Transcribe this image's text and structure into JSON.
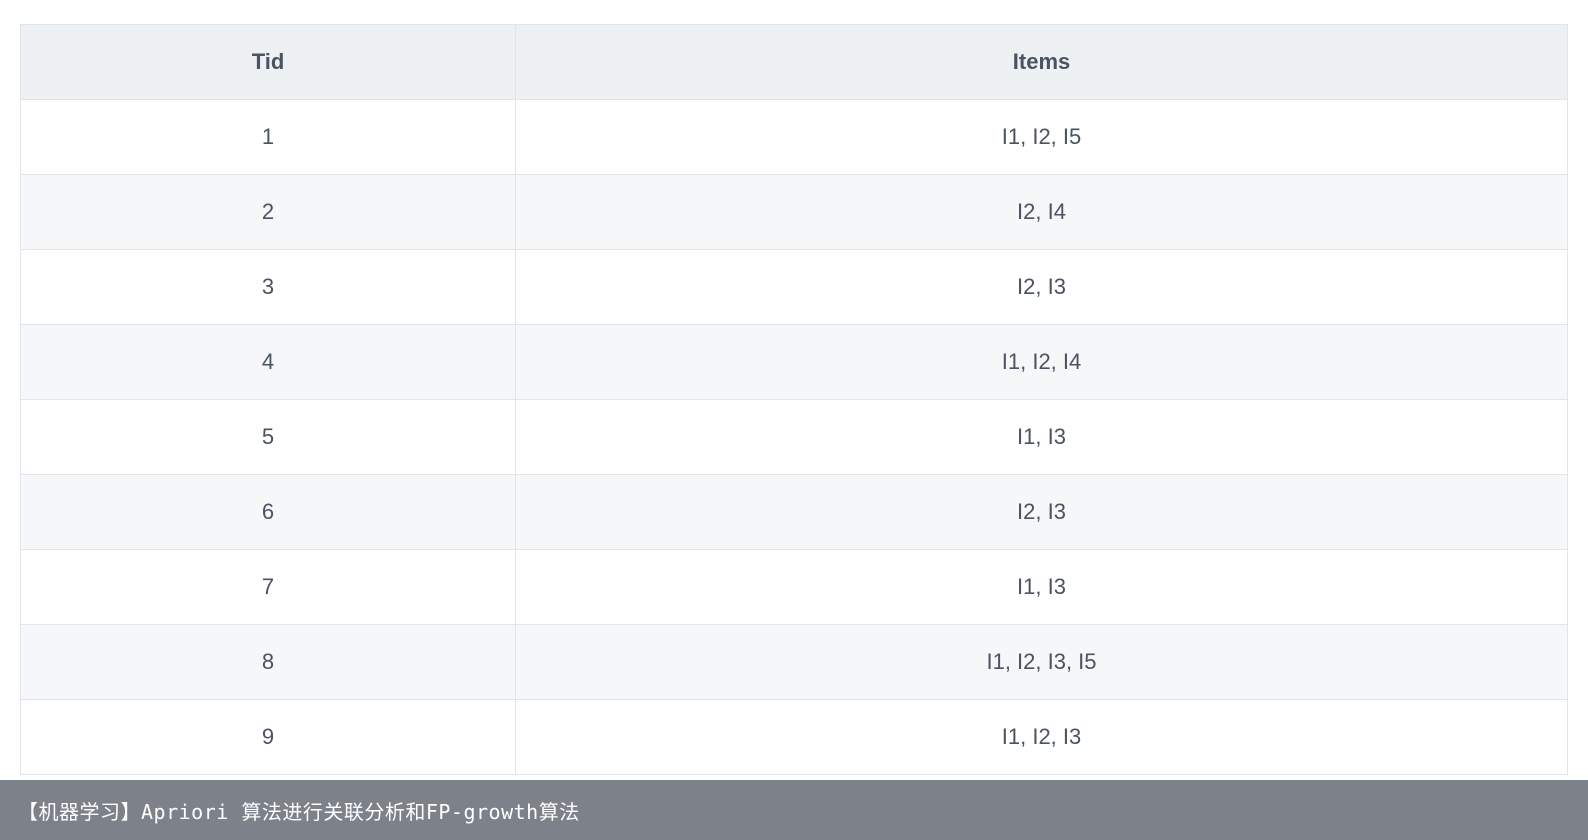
{
  "table": {
    "headers": [
      "Tid",
      "Items"
    ],
    "rows": [
      {
        "tid": "1",
        "items": "I1, I2, I5"
      },
      {
        "tid": "2",
        "items": "I2, I4"
      },
      {
        "tid": "3",
        "items": "I2, I3"
      },
      {
        "tid": "4",
        "items": "I1, I2, I4"
      },
      {
        "tid": "5",
        "items": "I1, I3"
      },
      {
        "tid": "6",
        "items": "I2, I3"
      },
      {
        "tid": "7",
        "items": "I1, I3"
      },
      {
        "tid": "8",
        "items": "I1, I2, I3, I5"
      },
      {
        "tid": "9",
        "items": "I1, I2, I3"
      }
    ]
  },
  "caption": "【机器学习】Apriori 算法进行关联分析和FP-growth算法"
}
